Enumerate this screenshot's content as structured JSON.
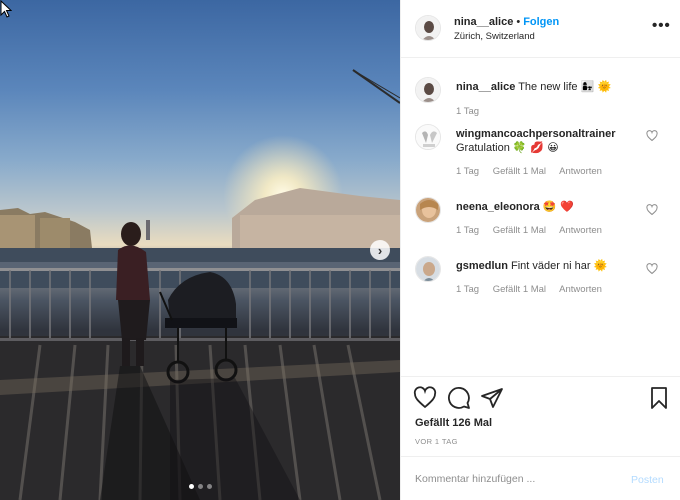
{
  "post": {
    "username": "nina__alice",
    "follow_label": "Folgen",
    "separator": "•",
    "location": "Zürich, Switzerland",
    "more_label": "•••"
  },
  "photo": {
    "carousel_index": 1,
    "carousel_count": 3,
    "next_label": "›"
  },
  "comments": [
    {
      "username": "nina__alice",
      "text": "The new life",
      "emojis": "👩‍👧 🌞",
      "time": "1 Tag",
      "likes": "",
      "reply": ""
    },
    {
      "username": "wingmancoachpersonaltrainer",
      "text": "Gratulation",
      "emojis": "🍀 💋 😀",
      "time": "1 Tag",
      "likes": "Gefällt 1 Mal",
      "reply": "Antworten"
    },
    {
      "username": "neena_eleonora",
      "text": "",
      "emojis": "🤩 ❤️",
      "time": "1 Tag",
      "likes": "Gefällt 1 Mal",
      "reply": "Antworten"
    },
    {
      "username": "gsmedlun",
      "text": "Fint väder ni har",
      "emojis": "🌞",
      "time": "1 Tag",
      "likes": "Gefällt 1 Mal",
      "reply": "Antworten"
    }
  ],
  "actions": {
    "likes_text": "Gefällt 126 Mal",
    "date_text": "VOR 1 TAG"
  },
  "composer": {
    "placeholder": "Kommentar hinzufügen ...",
    "post_label": "Posten"
  },
  "colors": {
    "accent": "#0095f6",
    "muted": "#8e8e8e",
    "post_disabled": "#b3dbff"
  }
}
